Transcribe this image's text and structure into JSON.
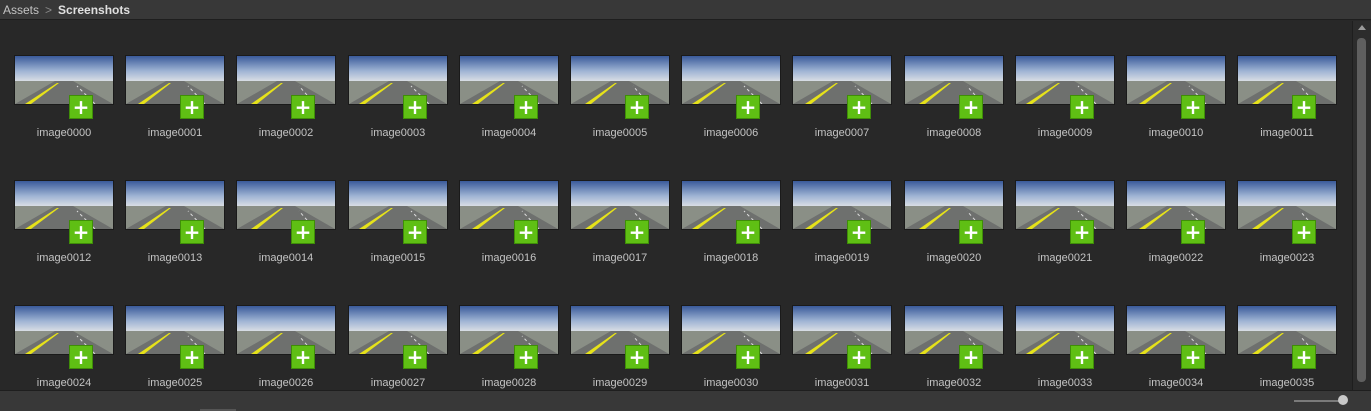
{
  "breadcrumb": {
    "root": "Assets",
    "separator": ">",
    "current": "Screenshots"
  },
  "items": [
    "image0000",
    "image0001",
    "image0002",
    "image0003",
    "image0004",
    "image0005",
    "image0006",
    "image0007",
    "image0008",
    "image0009",
    "image0010",
    "image0011",
    "image0012",
    "image0013",
    "image0014",
    "image0015",
    "image0016",
    "image0017",
    "image0018",
    "image0019",
    "image0020",
    "image0021",
    "image0022",
    "image0023",
    "image0024",
    "image0025",
    "image0026",
    "image0027",
    "image0028",
    "image0029",
    "image0030",
    "image0031",
    "image0032",
    "image0033",
    "image0034",
    "image0035"
  ],
  "add_badge": {
    "glyph": "+",
    "icon": "plus-icon",
    "color": "#5fbf14"
  },
  "colors": {
    "background": "#282828",
    "toolbar": "#383838"
  }
}
